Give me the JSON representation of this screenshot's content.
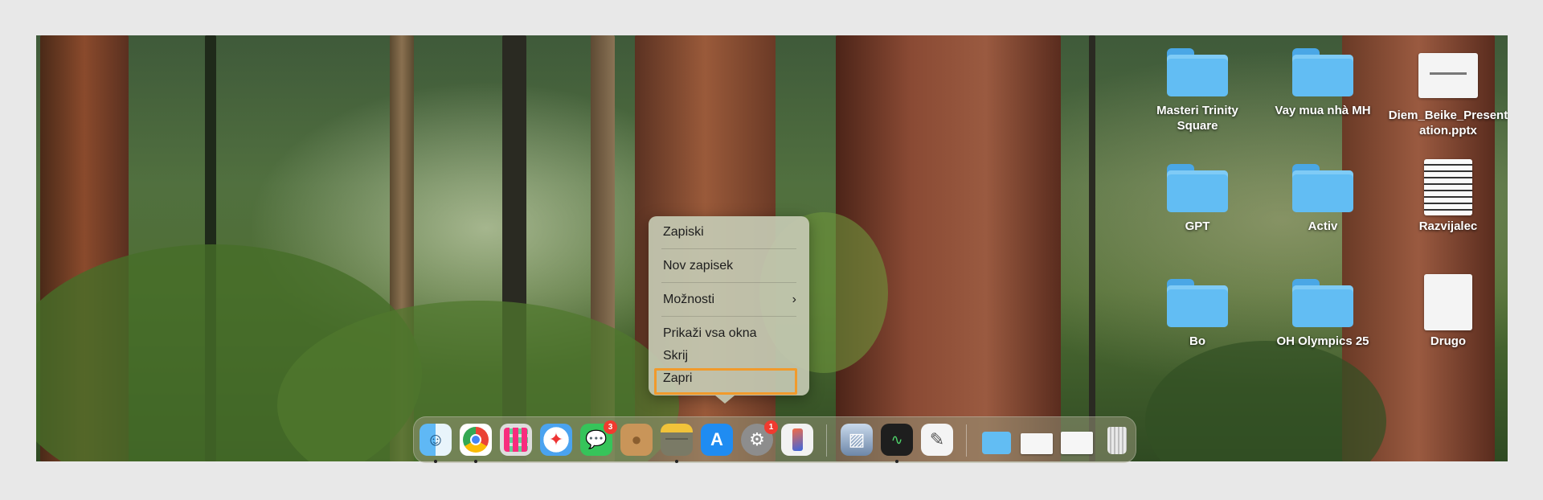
{
  "desktop": {
    "icons": [
      {
        "label": "Masteri Trinity Square",
        "kind": "folder"
      },
      {
        "label": "Vay mua nhà MH",
        "kind": "folder"
      },
      {
        "label": "Diem_Beike_Presentation.pptx",
        "kind": "slide"
      },
      {
        "label": "GPT",
        "kind": "folder"
      },
      {
        "label": "Activ",
        "kind": "folder"
      },
      {
        "label": "Razvijalec",
        "kind": "document"
      },
      {
        "label": "Bo",
        "kind": "folder"
      },
      {
        "label": "OH Olympics 25",
        "kind": "folder"
      },
      {
        "label": "Drugo",
        "kind": "document"
      }
    ]
  },
  "context_menu": {
    "items": [
      "Zapiski",
      "Nov zapisek",
      "Možnosti",
      "Prikaži vsa okna",
      "Skrij",
      "Zapri"
    ],
    "submenu_icon": "chevron-right-icon",
    "highlighted_item": "Zapri",
    "highlight_color": "#f19a2b"
  },
  "dock": {
    "apps": [
      {
        "name": "Finder",
        "icon": "finder-icon"
      },
      {
        "name": "Chrome",
        "icon": "chrome-icon"
      },
      {
        "name": "Launchpad",
        "icon": "launchpad-icon"
      },
      {
        "name": "Safari",
        "icon": "safari-icon"
      },
      {
        "name": "Messages",
        "icon": "messages-icon",
        "badge": "3"
      },
      {
        "name": "Contacts",
        "icon": "contacts-icon"
      },
      {
        "name": "Notes",
        "icon": "notes-icon"
      },
      {
        "name": "App Store",
        "icon": "app-store-icon"
      },
      {
        "name": "System Settings",
        "icon": "settings-icon",
        "badge": "1"
      },
      {
        "name": "iPhone Mirroring",
        "icon": "iphone-mirroring-icon"
      },
      {
        "name": "Preview",
        "icon": "preview-icon"
      },
      {
        "name": "Activity Monitor",
        "icon": "activity-monitor-icon"
      },
      {
        "name": "TextEdit",
        "icon": "textedit-icon"
      },
      {
        "name": "Documents",
        "icon": "folder-stack-icon"
      },
      {
        "name": "Downloads",
        "icon": "file-stack-icon"
      },
      {
        "name": "Recent",
        "icon": "file-stack-icon"
      },
      {
        "name": "Trash",
        "icon": "trash-icon"
      }
    ]
  }
}
